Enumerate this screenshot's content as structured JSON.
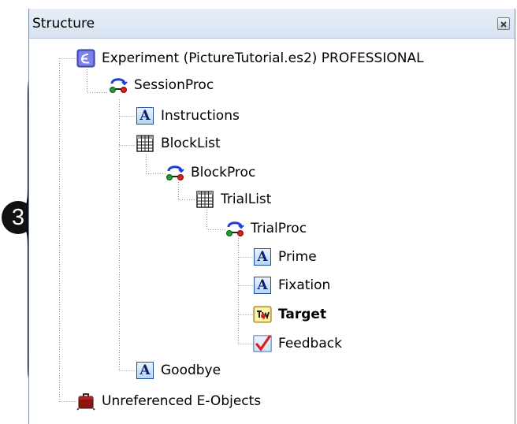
{
  "panel": {
    "title": "Structure"
  },
  "callout": {
    "number": "3"
  },
  "tree": [
    {
      "label": "Experiment (PictureTutorial.es2) PROFESSIONAL",
      "icon": "experiment-icon"
    },
    {
      "label": "SessionProc",
      "icon": "procedure-icon"
    },
    {
      "label": "Instructions",
      "icon": "text-display-icon"
    },
    {
      "label": "BlockList",
      "icon": "list-icon"
    },
    {
      "label": "BlockProc",
      "icon": "procedure-icon"
    },
    {
      "label": "TrialList",
      "icon": "list-icon"
    },
    {
      "label": "TrialProc",
      "icon": "procedure-icon"
    },
    {
      "label": "Prime",
      "icon": "text-display-icon"
    },
    {
      "label": "Fixation",
      "icon": "text-display-icon"
    },
    {
      "label": "Target",
      "icon": "image-display-icon",
      "bold": true
    },
    {
      "label": "Feedback",
      "icon": "feedback-icon"
    },
    {
      "label": "Goodbye",
      "icon": "text-display-icon"
    },
    {
      "label": "Unreferenced E-Objects",
      "icon": "unreferenced-objects-icon"
    }
  ],
  "colors": {
    "header_bg": "#d7e2f1",
    "tree_line": "#8c8c8c",
    "text_icon_fill": "#b5d6f7",
    "procedure_blue": "#1c3fd6",
    "procedure_red": "#d81e1e",
    "procedure_green": "#1e9e2e"
  }
}
